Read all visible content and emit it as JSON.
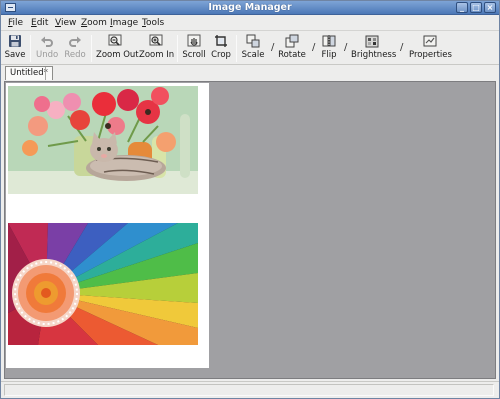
{
  "window": {
    "title": "Image Manager"
  },
  "title_buttons": {
    "minimize": "_",
    "maximize": "□",
    "close": "×"
  },
  "menu": [
    {
      "label": "File",
      "mnemonic": "F"
    },
    {
      "label": "Edit",
      "mnemonic": "E"
    },
    {
      "label": "View",
      "mnemonic": "V"
    },
    {
      "label": "Zoom",
      "mnemonic": "Z"
    },
    {
      "label": "Image",
      "mnemonic": "I"
    },
    {
      "label": "Tools",
      "mnemonic": "T"
    }
  ],
  "toolbar": {
    "save": "Save",
    "undo": "Undo",
    "redo": "Redo",
    "zoom_out": "Zoom Out",
    "zoom_in": "Zoom In",
    "scroll": "Scroll",
    "crop": "Crop",
    "scale": "Scale",
    "rotate": "Rotate",
    "flip": "Flip",
    "brightness": "Brightness",
    "properties": "Properties",
    "separator_glyph": "/"
  },
  "tabs": [
    {
      "label": "Untitled*"
    }
  ],
  "document": {
    "images": [
      {
        "subject": "flowers-and-kitten"
      },
      {
        "subject": "rainbow-flower-petals"
      }
    ]
  },
  "colors": {
    "titlebar": "#4c78b7",
    "canvas_bg": "#a0a0a3",
    "page_bg": "#ffffff",
    "window_bg": "#ededec"
  }
}
